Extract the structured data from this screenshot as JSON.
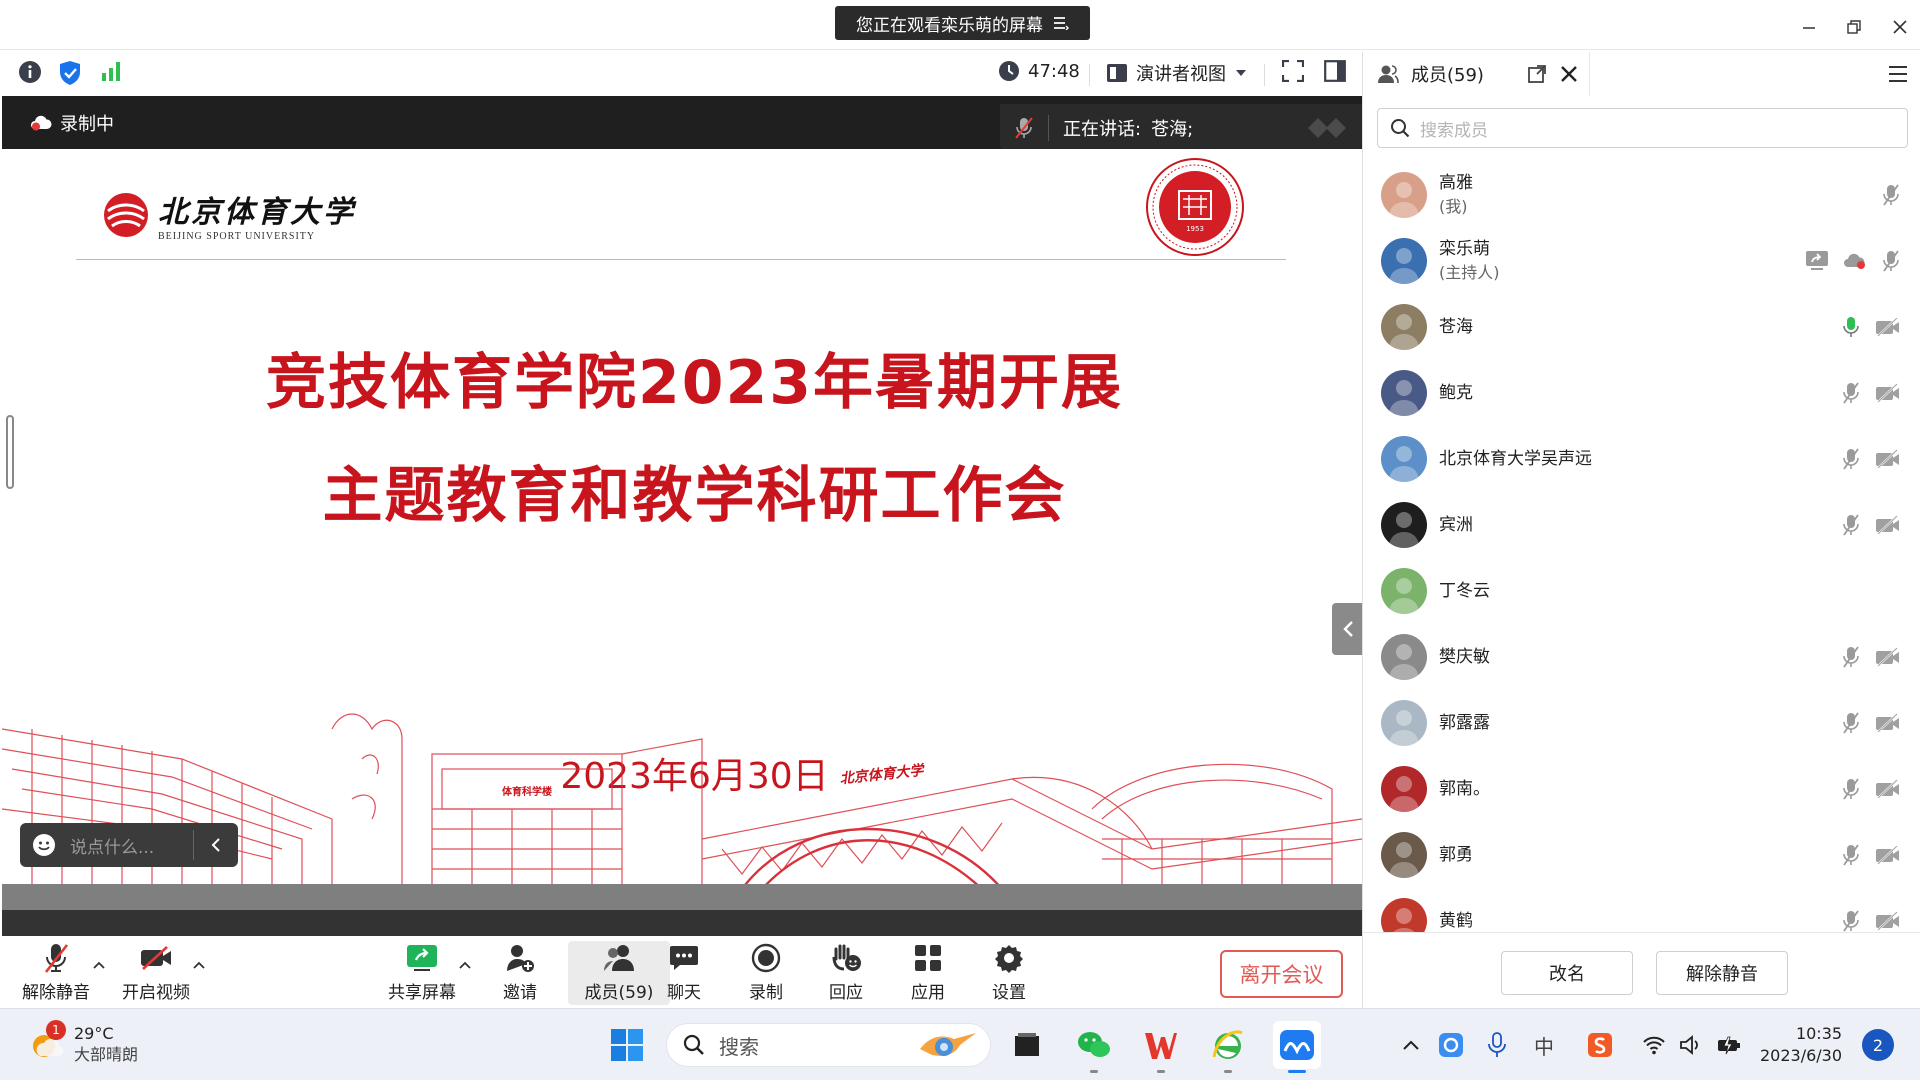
{
  "window": {
    "share_banner": "您正在观看栾乐萌的屏幕"
  },
  "topbar": {
    "timer": "47:48",
    "view_mode": "演讲者视图"
  },
  "stage": {
    "recording_label": "录制中",
    "speaking_label": "正在讲话:",
    "speaking_name": "苍海;",
    "chat_placeholder": "说点什么..."
  },
  "slide": {
    "logo_cn": "北京体育大学",
    "logo_en": "BEIJING SPORT UNIVERSITY",
    "title_line1": "竞技体育学院2023年暑期开展",
    "title_line2": "主题教育和教学科研工作会",
    "date": "2023年6月30日",
    "building_sign": "体育科学楼",
    "bridge_sign": "北京体育大学",
    "seal_year": "1953"
  },
  "controls": {
    "unmute": "解除静音",
    "start_video": "开启视频",
    "share_screen": "共享屏幕",
    "invite": "邀请",
    "members": "成员(59)",
    "chat": "聊天",
    "record": "录制",
    "reactions": "回应",
    "apps": "应用",
    "settings": "设置",
    "leave": "离开会议"
  },
  "panel": {
    "title": "成员(59)",
    "search_placeholder": "搜索成员",
    "rename_button": "改名",
    "unmute_button": "解除静音",
    "members": [
      {
        "name": "高雅",
        "sub": "(我)",
        "mic": "muted",
        "video": "none",
        "avatar": "#d9a089"
      },
      {
        "name": "栾乐萌",
        "sub": "(主持人)",
        "mic": "muted",
        "video": "none",
        "share": true,
        "rec": true,
        "avatar": "#3a6fb0"
      },
      {
        "name": "苍海",
        "sub": "",
        "mic": "active",
        "video": "off",
        "avatar": "#8d7d62"
      },
      {
        "name": "鲍克",
        "sub": "",
        "mic": "muted",
        "video": "off",
        "avatar": "#4a5a86"
      },
      {
        "name": "北京体育大学吴声远",
        "sub": "",
        "mic": "muted",
        "video": "off",
        "avatar": "#5d8fc8"
      },
      {
        "name": "宾洲",
        "sub": "",
        "mic": "muted",
        "video": "off",
        "avatar": "#1e1e1e"
      },
      {
        "name": "丁冬云",
        "sub": "",
        "mic": "none",
        "video": "none",
        "avatar": "#7bb36a"
      },
      {
        "name": "樊庆敏",
        "sub": "",
        "mic": "muted",
        "video": "off",
        "avatar": "#8a8a8a"
      },
      {
        "name": "郭露露",
        "sub": "",
        "mic": "muted",
        "video": "off",
        "avatar": "#a9b8c4"
      },
      {
        "name": "郭南。",
        "sub": "",
        "mic": "muted",
        "video": "off",
        "avatar": "#b0282a"
      },
      {
        "name": "郭勇",
        "sub": "",
        "mic": "muted",
        "video": "off",
        "avatar": "#6b5a4a"
      },
      {
        "name": "黄鹤",
        "sub": "",
        "mic": "muted",
        "video": "off",
        "avatar": "#c0392b"
      }
    ]
  },
  "taskbar": {
    "weather_temp": "29°C",
    "weather_desc": "大部晴朗",
    "weather_badge": "1",
    "search_label": "搜索",
    "ime": "中",
    "time": "10:35",
    "date": "2023/6/30",
    "notification_count": "2"
  },
  "colors": {
    "brand_red": "#c8141c",
    "leave_red": "#e25a55",
    "dark_bar": "#1f1f1f",
    "mic_active": "#2fbf4f",
    "taskbar_bg": "#eef0f7"
  }
}
